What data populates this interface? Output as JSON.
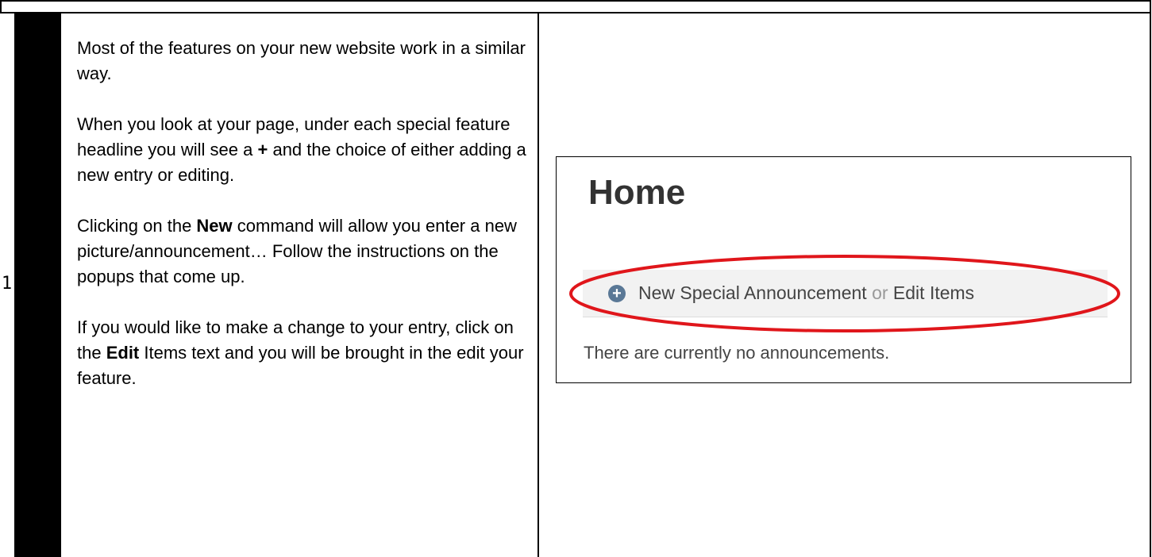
{
  "step": {
    "number": "1"
  },
  "instructions": {
    "p1": "Most of the features on your new website work in a similar way.",
    "p2_before": "When you look at your page, under each special feature headline you will see a ",
    "p2_bold": "+",
    "p2_after": " and the choice of either adding a new entry or editing.",
    "p3_before": "Clicking on the ",
    "p3_bold": "New",
    "p3_after": " command will allow you enter a new picture/announcement… Follow the instructions on the popups that come up.",
    "p4_before": "If you would like to make a change to your entry, click on the ",
    "p4_bold": "Edit",
    "p4_after": " Items text and you will be brought in the edit your feature."
  },
  "screenshot": {
    "title": "Home",
    "new_link": "New Special Announcement",
    "or_text": "or",
    "edit_link": "Edit Items",
    "empty_message": "There are currently no announcements.",
    "plus_icon": "plus-circle-icon",
    "highlight_color": "#e0161b"
  }
}
